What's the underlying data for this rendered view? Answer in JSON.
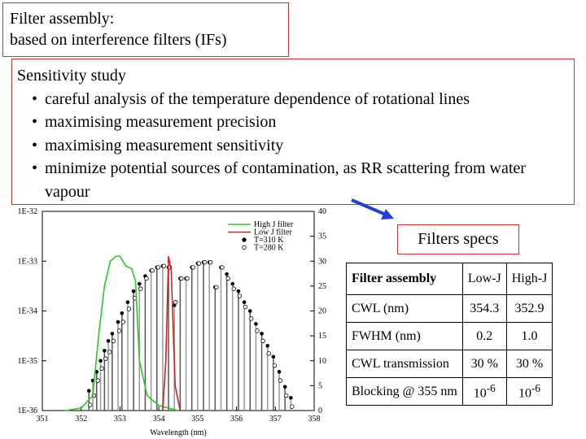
{
  "title_box": {
    "line1": "Filter assembly:",
    "line2": "based on interference filters (IFs)"
  },
  "sensitivity": {
    "heading": "Sensitivity study",
    "bullets": [
      "careful analysis of the temperature dependence of rotational lines",
      "maximising measurement precision",
      "maximising measurement sensitivity",
      "minimize potential sources of contamination, as RR scattering from water vapour"
    ]
  },
  "specs_label": "Filters specs",
  "table": {
    "header": [
      "Filter assembly",
      "Low-J",
      "High-J"
    ],
    "rows": [
      [
        "CWL (nm)",
        "354.3",
        "352.9"
      ],
      [
        "FWHM (nm)",
        "0.2",
        "1.0"
      ],
      [
        "CWL transmission",
        "30 %",
        "30 %"
      ],
      [
        "Blocking @ 355 nm",
        "10",
        "10"
      ]
    ],
    "blocking_exponent": "-6"
  },
  "colors": {
    "border": "#c0392b",
    "arrow": "#1f3fd6",
    "high_j": "#22cc22",
    "low_j": "#cc2222"
  },
  "chart_data": {
    "type": "line",
    "xlabel": "Wavelength (nm)",
    "xlim": [
      351,
      358
    ],
    "xticks": [
      "351",
      "352",
      "353",
      "354",
      "355",
      "356",
      "357",
      "358"
    ],
    "ylim_left": [
      1e-36,
      1e-32
    ],
    "yscale_left": "log",
    "yticks_left": [
      "1E-36",
      "1E-35",
      "1E-34",
      "1E-33",
      "1E-32"
    ],
    "ylim_right": [
      0,
      40
    ],
    "yticks_right": [
      "0",
      "5",
      "10",
      "15",
      "20",
      "25",
      "30",
      "35",
      "40"
    ],
    "legend": [
      "High J filter",
      "Low J filter",
      "T=310 K",
      "T=280 K"
    ],
    "legend_placement": "top-right",
    "lines": {
      "wavelength": [
        352.2,
        352.3,
        352.4,
        352.5,
        352.6,
        352.7,
        352.8,
        352.95,
        353.05,
        353.2,
        353.35,
        353.5,
        353.65,
        353.8,
        353.95,
        354.1,
        354.25,
        354.4,
        354.55,
        354.7,
        354.85,
        355.0,
        355.15,
        355.3,
        355.45,
        355.6,
        355.75,
        355.9,
        356.05,
        356.2,
        356.35,
        356.5,
        356.65,
        356.8,
        356.95,
        357.1,
        357.25,
        357.4
      ],
      "T310": [
        2.5e-36,
        4e-36,
        6e-36,
        1e-35,
        1.6e-35,
        2.5e-35,
        3.5e-35,
        6e-35,
        9e-35,
        1.5e-34,
        2.5e-34,
        3.5e-34,
        5e-34,
        6.5e-34,
        7.5e-34,
        8e-34,
        7.5e-34,
        1.3e-34,
        4.5e-34,
        4.5e-34,
        7.5e-34,
        9e-34,
        9.5e-34,
        9.5e-34,
        3e-34,
        7.5e-34,
        5.5e-34,
        3.5e-34,
        2.5e-34,
        1.5e-34,
        1e-34,
        5.5e-35,
        3.5e-35,
        2e-35,
        1.2e-35,
        6e-36,
        3e-36,
        1.8e-36
      ],
      "T280": [
        1.3e-36,
        2e-36,
        4e-36,
        7e-36,
        1.1e-35,
        1.5e-35,
        2.5e-35,
        4e-35,
        6e-35,
        1.1e-34,
        1.8e-34,
        2.8e-34,
        4.5e-34,
        6.5e-34,
        7.5e-34,
        8e-34,
        7.5e-34,
        1.5e-34,
        4.5e-34,
        4.5e-34,
        7.5e-34,
        9e-34,
        9.5e-34,
        9.5e-34,
        3e-34,
        7.5e-34,
        4.5e-34,
        2.8e-34,
        2e-34,
        1.2e-34,
        7e-35,
        4e-35,
        2.5e-35,
        1.4e-35,
        8e-36,
        4e-36,
        2e-36,
        1.2e-36
      ]
    },
    "series": [
      {
        "name": "High J filter",
        "x": [
          351.6,
          352.0,
          352.3,
          352.45,
          352.6,
          352.75,
          352.9,
          353.0,
          353.15,
          353.3,
          353.4,
          353.5,
          353.7,
          354.0,
          354.5
        ],
        "y": [
          0,
          0.5,
          3,
          15,
          25,
          30,
          31,
          31,
          29,
          28.5,
          26,
          10,
          3,
          1,
          0
        ]
      },
      {
        "name": "Low J filter",
        "x": [
          354.1,
          354.18,
          354.25,
          354.32,
          354.42,
          354.55
        ],
        "y": [
          0,
          10,
          31,
          28,
          5,
          0
        ]
      }
    ]
  }
}
